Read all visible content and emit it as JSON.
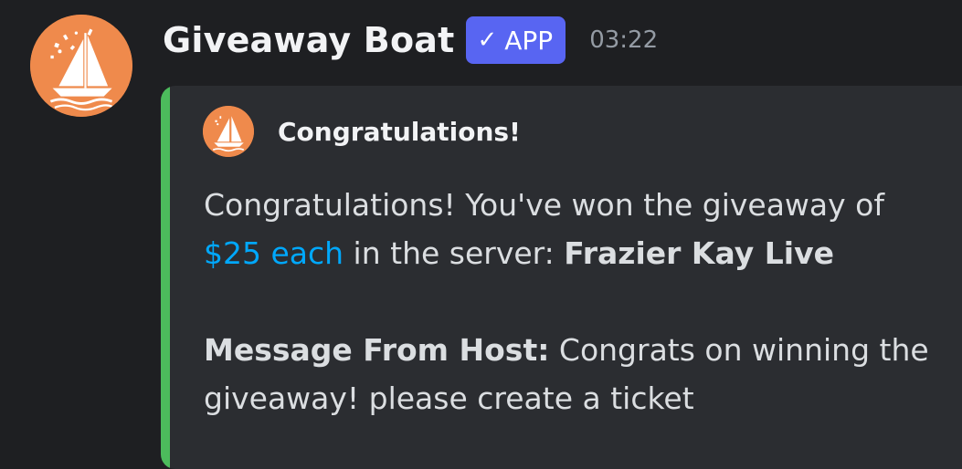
{
  "message": {
    "author": "Giveaway Boat",
    "badge": {
      "check": "✓",
      "label": "APP"
    },
    "timestamp": "03:22",
    "avatar_icon": "sailboat-confetti-icon",
    "colors": {
      "avatar_bg": "#ef8a4c",
      "badge_bg": "#5865f2",
      "embed_accent": "#4cbb5c",
      "link": "#00a8fc"
    }
  },
  "embed": {
    "author_name": "Congratulations!",
    "line1": "Congratulations! You've won the giveaway of",
    "prize_link": "$25 each",
    "line2_middle": " in the server: ",
    "server_name": "Frazier Kay Live",
    "host_label": "Message From Host:",
    "host_message_line1": " Congrats on winning the",
    "host_message_line2": "giveaway! please create a ticket"
  }
}
